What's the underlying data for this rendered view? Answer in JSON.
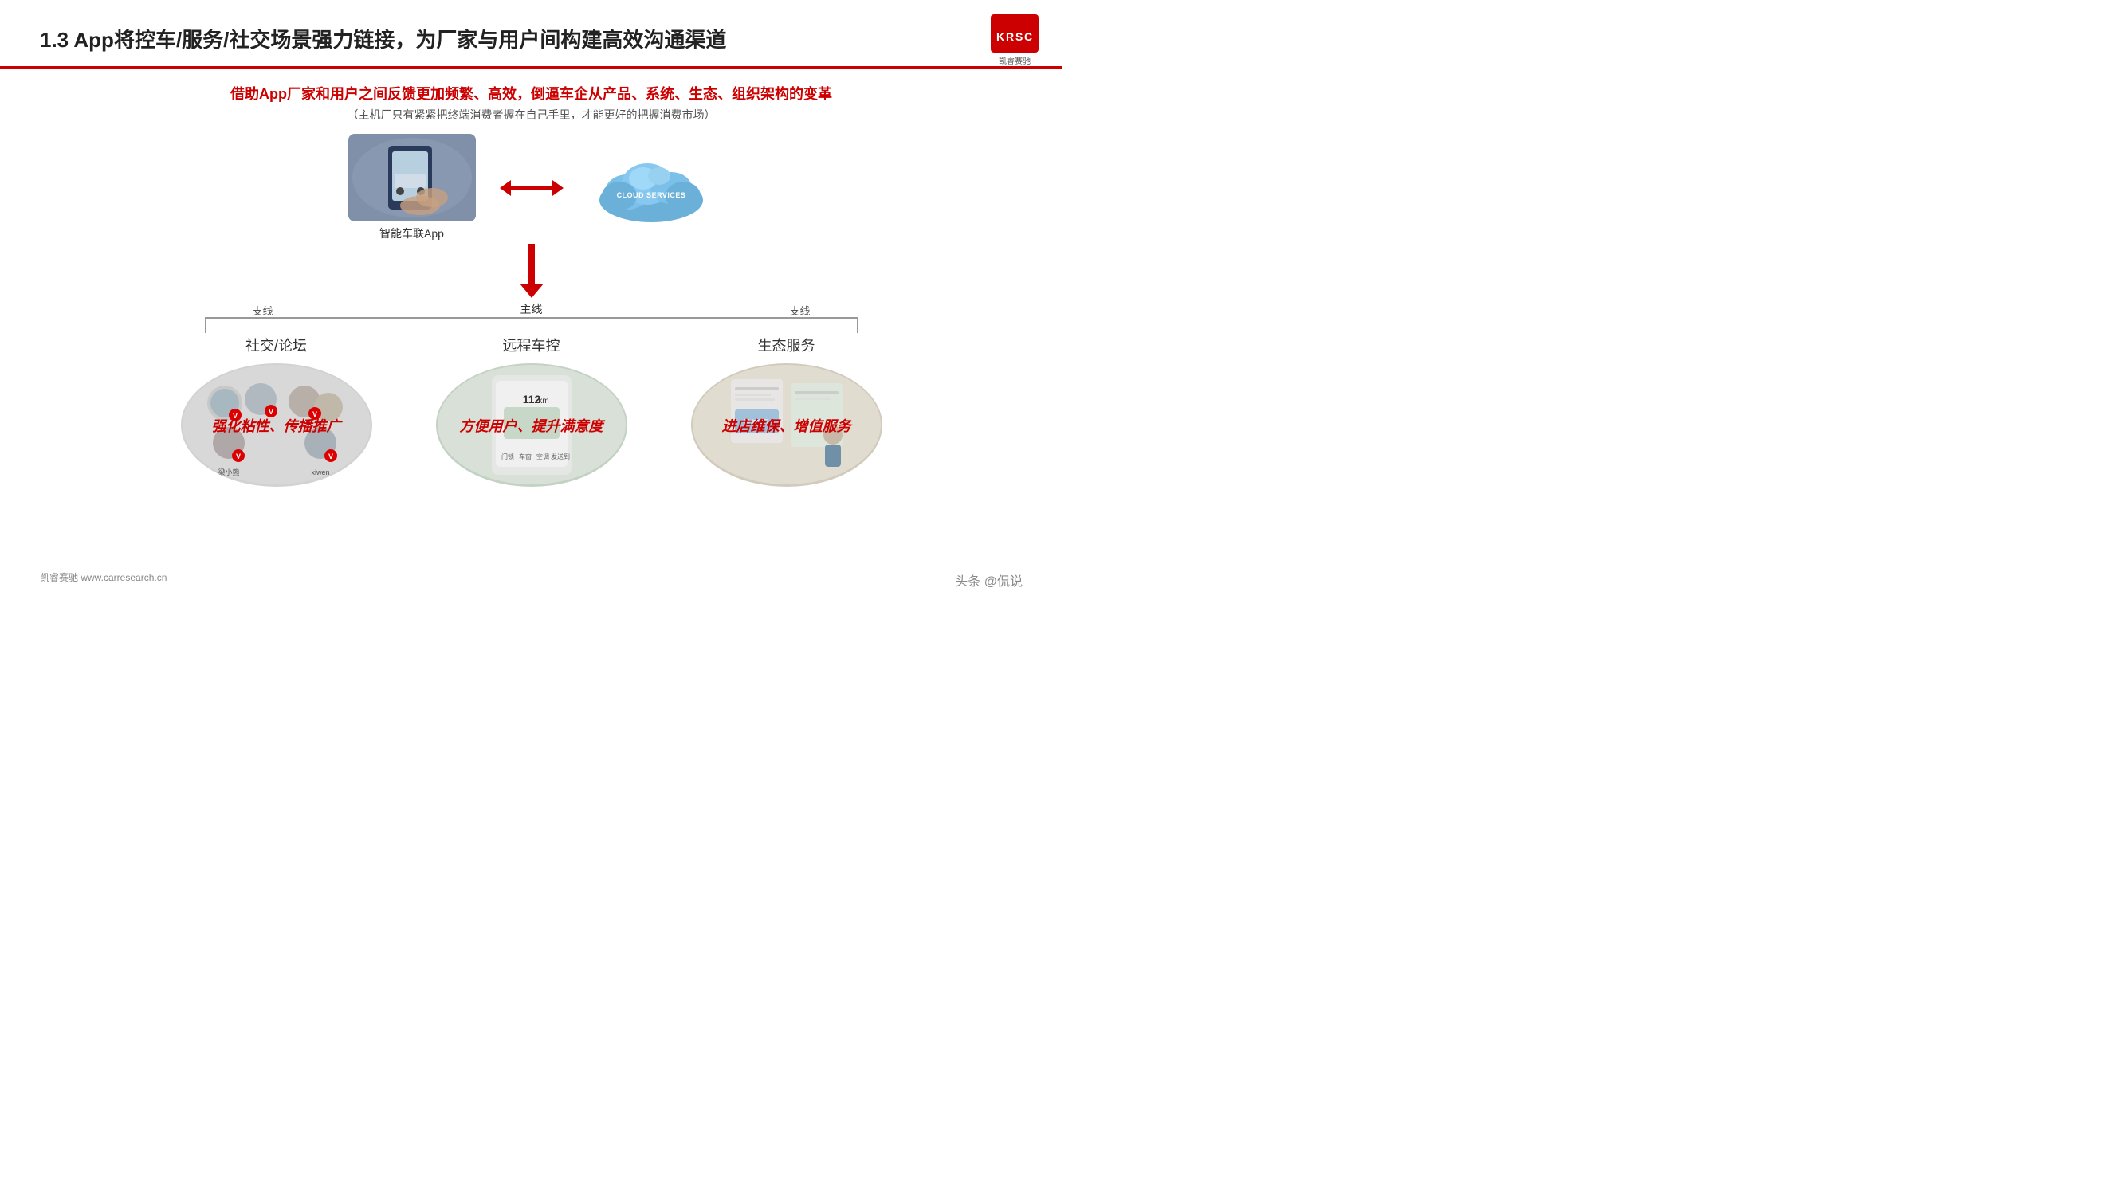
{
  "header": {
    "title": "1.3 App将控车/服务/社交场景强力链接，为厂家与用户间构建高效沟通渠道",
    "logo_letters": "KRSC",
    "logo_subtext": "凯睿赛驰"
  },
  "subtitle": {
    "main": "借助App厂家和用户之间反馈更加频繁、高效，倒逼车企从产品、系统、生态、组织架构的变革",
    "sub": "（主机厂只有紧紧把终端消费者握在自己手里，才能更好的把握消费市场）"
  },
  "diagram": {
    "app_label": "智能车联App",
    "cloud_text": "CLOUD SERVICES",
    "arrow_label": "主线",
    "branch_left": "支线",
    "branch_right": "支线"
  },
  "columns": [
    {
      "title": "社交/论坛",
      "label": "强化粘性、传播推广",
      "oval_type": "social"
    },
    {
      "title": "远程车控",
      "label": "方便用户、提升满意度",
      "oval_type": "remote"
    },
    {
      "title": "生态服务",
      "label": "进店维保、增值服务",
      "oval_type": "eco"
    }
  ],
  "footer": {
    "left": "凯睿赛驰 www.carresearch.cn",
    "right": "头条 @侃说"
  }
}
